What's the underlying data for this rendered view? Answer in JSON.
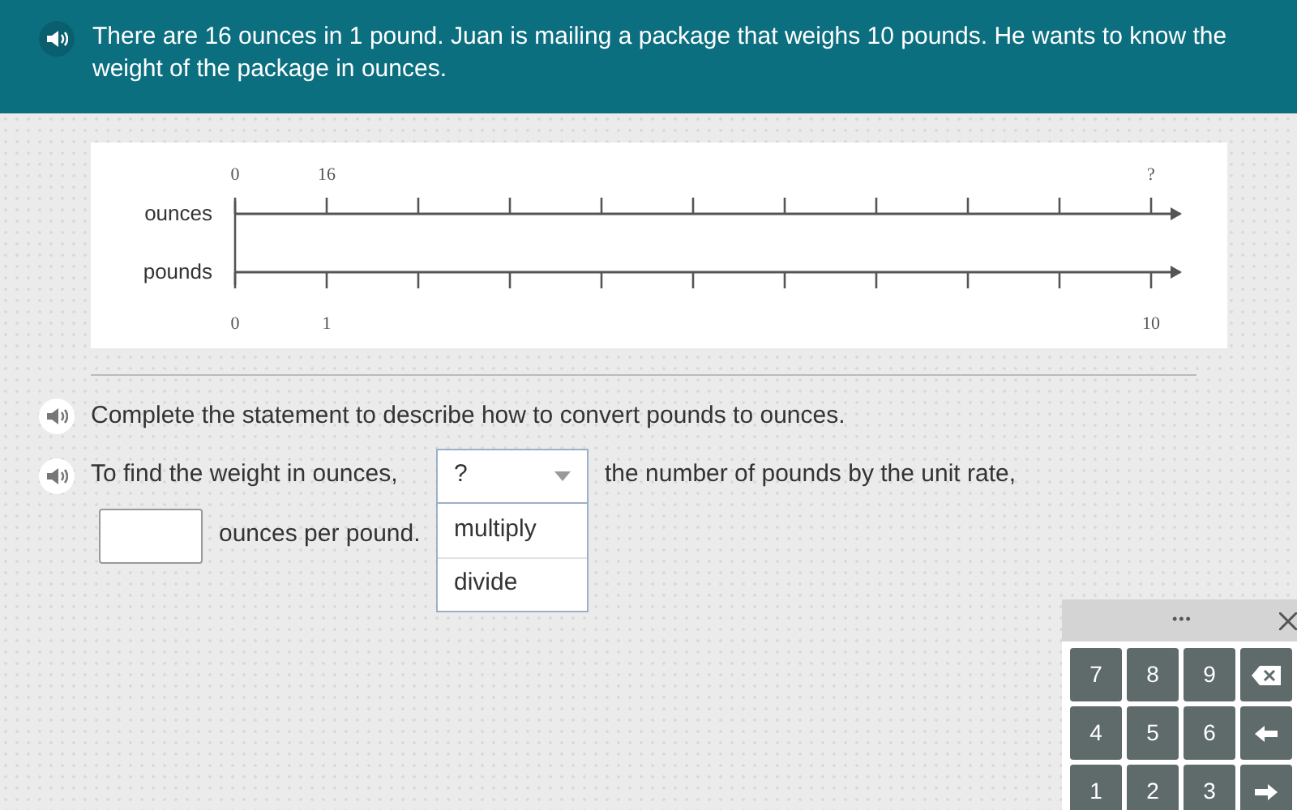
{
  "header": {
    "question": "There are 16 ounces in 1 pound. Juan is mailing a package that weighs 10 pounds. He wants to know the weight of the package in ounces."
  },
  "number_line": {
    "rows": [
      {
        "label": "ounces",
        "start_label": "0",
        "second_label": "16",
        "end_label": "?"
      },
      {
        "label": "pounds",
        "start_label": "0",
        "second_label": "1",
        "end_label": "10"
      }
    ]
  },
  "instruction": "Complete the statement to describe how to convert pounds to ounces.",
  "statement": {
    "before": "To find the weight in ounces,",
    "dropdown": {
      "value": "?",
      "expanded": true,
      "options": [
        "multiply",
        "divide"
      ]
    },
    "after": "the number of pounds by the unit rate,",
    "unit_text": "ounces per pound."
  },
  "keypad": {
    "title": "•••",
    "keys": [
      {
        "kind": "digit",
        "label": "7"
      },
      {
        "kind": "digit",
        "label": "8"
      },
      {
        "kind": "digit",
        "label": "9"
      },
      {
        "kind": "backspace"
      },
      {
        "kind": "digit",
        "label": "4"
      },
      {
        "kind": "digit",
        "label": "5"
      },
      {
        "kind": "digit",
        "label": "6"
      },
      {
        "kind": "left"
      },
      {
        "kind": "digit",
        "label": "1"
      },
      {
        "kind": "digit",
        "label": "2"
      },
      {
        "kind": "digit",
        "label": "3"
      },
      {
        "kind": "right"
      }
    ]
  }
}
